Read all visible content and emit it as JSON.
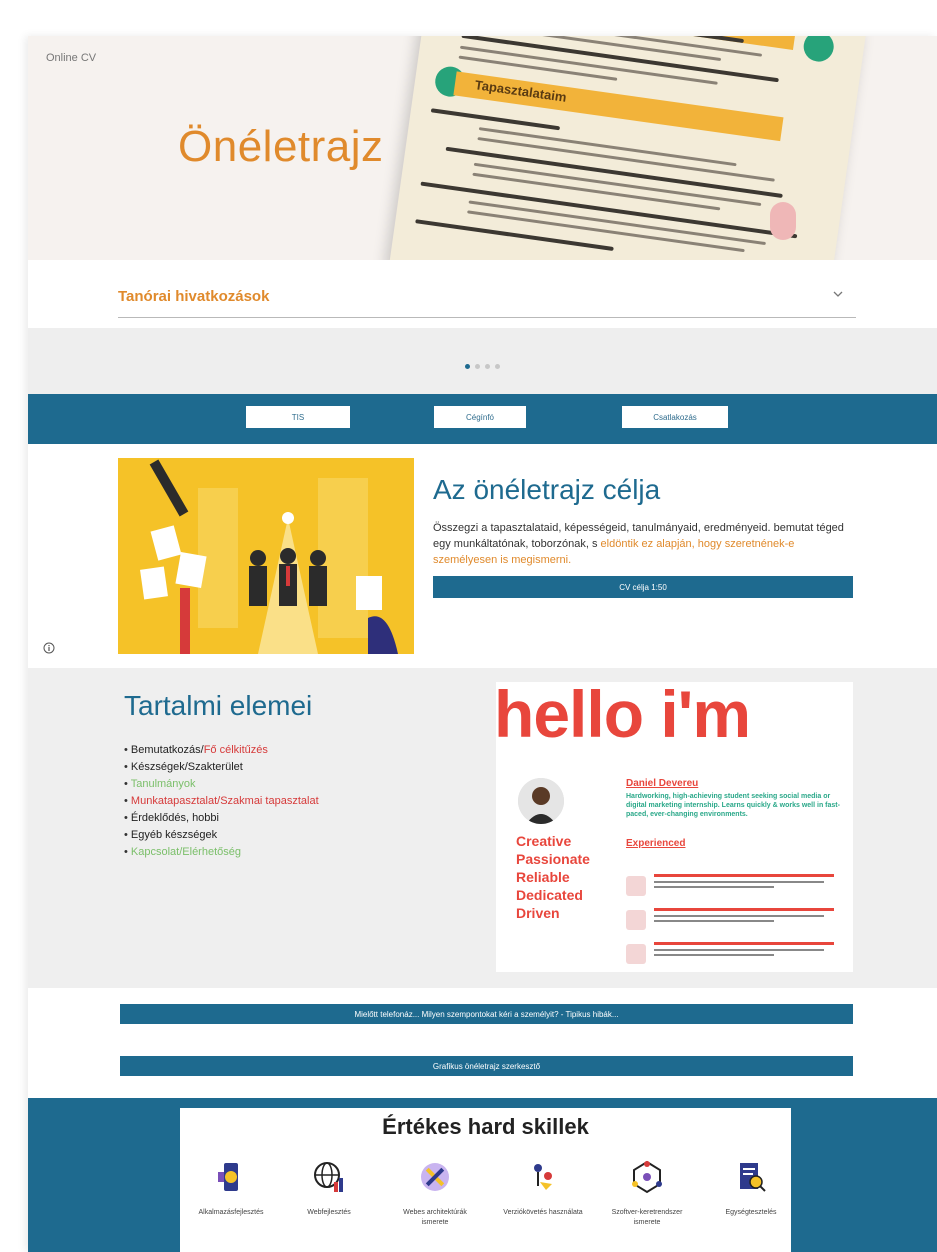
{
  "site": {
    "label": "Online CV"
  },
  "hero": {
    "title": "Önéletrajz",
    "paper_heading": "Tapasztalataim"
  },
  "dropdown": {
    "label": "Tanórai hivatkozások"
  },
  "carousel": {
    "dots": 4,
    "active_index": 0
  },
  "nav": {
    "buttons": [
      {
        "label": "TIS"
      },
      {
        "label": "Cégínfó"
      },
      {
        "label": "Csatlakozás"
      }
    ]
  },
  "purpose": {
    "title": "Az önéletrajz célja",
    "text_main": "Összegzi a tapasztalataid, képességeid, tanulmányaid, eredményeid. bemutat téged egy munkáltatónak, toborzónak, s ",
    "text_highlight": "eldöntik ez alapján, hogy szeretnének-e személyesen is megismerni.",
    "button_label": "CV célja 1:50"
  },
  "contents": {
    "title": "Tartalmi elemei",
    "items": [
      {
        "prefix": "Bemutatkozás/",
        "rest": "Fő célkitűzés"
      },
      {
        "text": "Készségek/Szakterület"
      },
      {
        "text": "Tanulmányok"
      },
      {
        "text": "Munkatapasztalat/Szakmai tapasztalat"
      },
      {
        "text": "Érdeklődés, hobbi"
      },
      {
        "text": "Egyéb készségek"
      },
      {
        "text": "Kapcsolat/Elérhetőség"
      }
    ]
  },
  "cv_sample": {
    "headline": "hello i'm",
    "name": "Daniel Devereu",
    "summary": "Hardworking, high-achieving student seeking social media or digital marketing internship. Learns quickly & works well in fast-paced, ever-changing environments.",
    "experience_label": "Experienced",
    "traits": [
      "Creative",
      "Passionate",
      "Reliable",
      "Dedicated",
      "Driven"
    ]
  },
  "links": {
    "interview_tips": "Mielőtt telefonáz... Milyen szempontokat kéri a személyit? - Tipikus hibák...",
    "free_editor": "Grafikus önéletrajz szerkesztő"
  },
  "skills": {
    "title": "Értékes hard skillek",
    "items": [
      {
        "label": "Alkalmazásfejlesztés",
        "icon": "app-dev-icon"
      },
      {
        "label": "Webfejlesztés",
        "icon": "globe-chart-icon"
      },
      {
        "label": "Webes architektúrák ismerete",
        "icon": "architecture-icon"
      },
      {
        "label": "Verziókövetés használata",
        "icon": "version-control-icon"
      },
      {
        "label": "Szoftver-keretrendszer ismerete",
        "icon": "framework-icon"
      },
      {
        "label": "Egységtesztelés",
        "icon": "unit-test-icon"
      }
    ]
  },
  "colors": {
    "primary": "#1e6a8f",
    "accent": "#e08a2c",
    "red": "#d63a3a",
    "green": "#7bbf6a"
  }
}
